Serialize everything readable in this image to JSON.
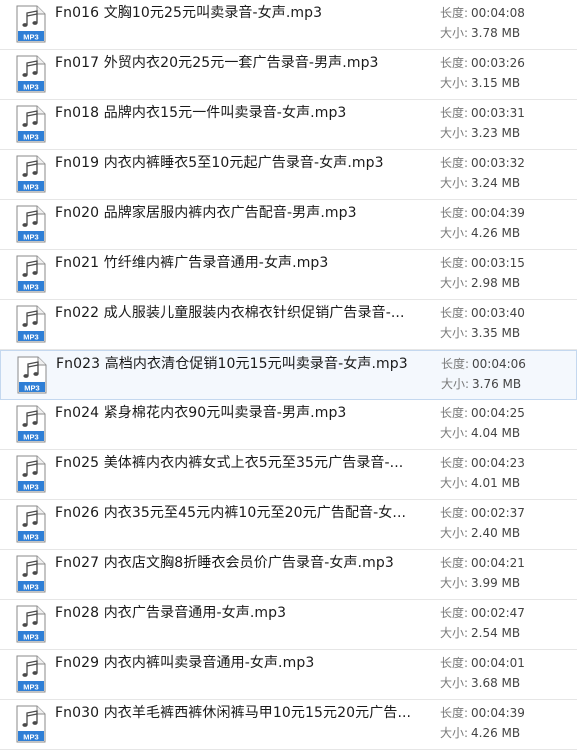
{
  "labels": {
    "duration": "长度:",
    "size": "大小:",
    "file_type": "MP3"
  },
  "colors": {
    "icon_blue": "#2f7fd6",
    "selected_bg": "#f4f8fd",
    "selected_border": "#c4d8ef"
  },
  "files": [
    {
      "name": "Fn016 文胸10元25元叫卖录音-女声.mp3",
      "duration": "00:04:08",
      "size": "3.78 MB"
    },
    {
      "name": "Fn017 外贸内衣20元25元一套广告录音-男声.mp3",
      "duration": "00:03:26",
      "size": "3.15 MB"
    },
    {
      "name": "Fn018 品牌内衣15元一件叫卖录音-女声.mp3",
      "duration": "00:03:31",
      "size": "3.23 MB"
    },
    {
      "name": "Fn019 内衣内裤睡衣5至10元起广告录音-女声.mp3",
      "duration": "00:03:32",
      "size": "3.24 MB"
    },
    {
      "name": "Fn020 品牌家居服内裤内衣广告配音-男声.mp3",
      "duration": "00:04:39",
      "size": "4.26 MB"
    },
    {
      "name": "Fn021 竹纤维内裤广告录音通用-女声.mp3",
      "duration": "00:03:15",
      "size": "2.98 MB"
    },
    {
      "name": "Fn022 成人服装儿童服装内衣棉衣针织促销广告录音-...",
      "duration": "00:03:40",
      "size": "3.35 MB"
    },
    {
      "name": "Fn023 高档内衣清仓促销10元15元叫卖录音-女声.mp3",
      "duration": "00:04:06",
      "size": "3.76 MB",
      "selected": true
    },
    {
      "name": "Fn024 紧身棉花内衣90元叫卖录音-男声.mp3",
      "duration": "00:04:25",
      "size": "4.04 MB"
    },
    {
      "name": "Fn025 美体裤内衣内裤女式上衣5元至35元广告录音-...",
      "duration": "00:04:23",
      "size": "4.01 MB"
    },
    {
      "name": "Fn026 内衣35元至45元内裤10元至20元广告配音-女...",
      "duration": "00:02:37",
      "size": "2.40 MB"
    },
    {
      "name": "Fn027 内衣店文胸8折睡衣会员价广告录音-女声.mp3",
      "duration": "00:04:21",
      "size": "3.99 MB"
    },
    {
      "name": "Fn028 内衣广告录音通用-女声.mp3",
      "duration": "00:02:47",
      "size": "2.54 MB"
    },
    {
      "name": "Fn029 内衣内裤叫卖录音通用-女声.mp3",
      "duration": "00:04:01",
      "size": "3.68 MB"
    },
    {
      "name": "Fn030 内衣羊毛裤西裤休闲裤马甲10元15元20元广告...",
      "duration": "00:04:39",
      "size": "4.26 MB"
    }
  ]
}
